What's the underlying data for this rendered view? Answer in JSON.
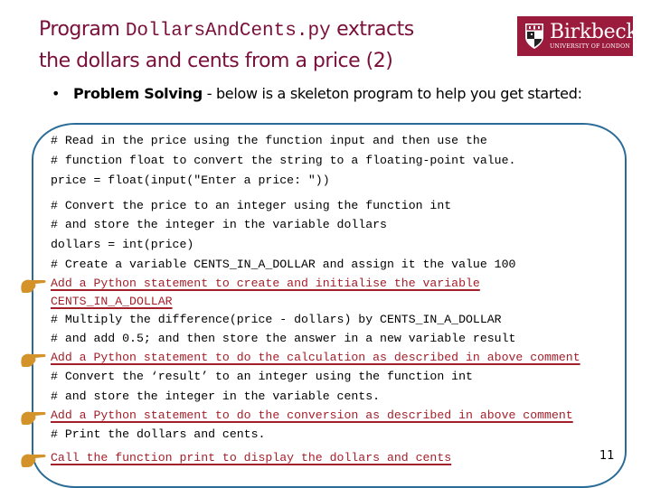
{
  "title": {
    "prefix": "Program ",
    "filename": "DollarsAndCents.py",
    "suffix": " extracts",
    "line2": "the dollars and cents from a price (2)"
  },
  "logo": {
    "name": "Birkbeck",
    "subtitle": "UNIVERSITY OF LONDON",
    "color": "#9b1b3c"
  },
  "bullet": {
    "marker": "•",
    "bold": "Problem Solving",
    "rest": " - below is a skeleton program to help you get started:"
  },
  "code_lines": [
    {
      "text": "# Read in the price using the function input and then use the",
      "type": "comment"
    },
    {
      "text": "# function float to convert the string to a floating-point value.",
      "type": "comment"
    },
    {
      "text": "price = float(input(\"Enter a price: \"))",
      "type": "code"
    },
    {
      "text": "# Convert the price to an integer using the function int",
      "type": "comment"
    },
    {
      "text": "# and store the integer in the variable dollars",
      "type": "comment"
    },
    {
      "text": "dollars = int(price)",
      "type": "code"
    },
    {
      "text": "# Create a variable CENTS_IN_A_DOLLAR and assign it the value 100",
      "type": "comment"
    },
    {
      "text": "Add a Python statement to create and initialise the variable",
      "type": "task",
      "icon": "pointing-hand-icon"
    },
    {
      "text": "CENTS_IN_A_DOLLAR",
      "type": "task"
    },
    {
      "text": "# Multiply the difference(price - dollars) by CENTS_IN_A_DOLLAR",
      "type": "comment"
    },
    {
      "text": "# and add 0.5; and then store the answer in a new variable result",
      "type": "comment"
    },
    {
      "text": "Add a Python statement to do the calculation as described in above comment",
      "type": "task",
      "icon": "pointing-hand-icon"
    },
    {
      "text": "# Convert the ‘result’ to an integer using the function int",
      "type": "comment"
    },
    {
      "text": "# and store the integer in the variable cents.",
      "type": "comment"
    },
    {
      "text": "Add a Python statement to do the conversion as described in above comment",
      "type": "task",
      "icon": "pointing-hand-icon"
    },
    {
      "text": "# Print the dollars and cents.",
      "type": "comment"
    },
    {
      "text": "Call the function print to display the dollars and cents",
      "type": "task",
      "icon": "pointing-hand-icon"
    }
  ],
  "page_number": "11",
  "colors": {
    "title": "#7a0f3a",
    "task": "#a3202b",
    "frame": "#2b6c96",
    "hand": "#d4922a"
  }
}
